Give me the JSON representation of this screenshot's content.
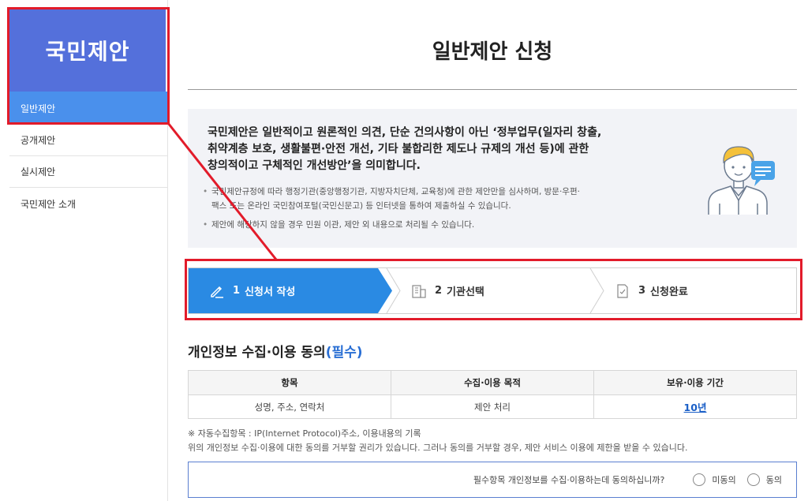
{
  "sidebar": {
    "title": "국민제안",
    "items": [
      {
        "label": "일반제안"
      },
      {
        "label": "공개제안"
      },
      {
        "label": "실시제안"
      },
      {
        "label": "국민제안 소개"
      }
    ]
  },
  "main": {
    "title": "일반제안 신청",
    "info": {
      "lead_lines": [
        "국민제안은 일반적이고 원론적인 의견, 단순 건의사항이 아닌 ‘정부업무(일자리 창출,",
        "취약계층 보호, 생활불편·안전 개선, 기타 불합리한 제도나 규제의 개선 등)에 관한",
        "창의적이고 구체적인 개선방안’을 의미합니다."
      ],
      "bullets": [
        {
          "line1": "국민제안규정에 따라 행정기관(중앙행정기관, 지방자치단체, 교육청)에 관한 제안만을 심사하며, 방문·우편·",
          "line2": "팩스 또는 온라인 국민참여포털(국민신문고) 등 인터넷을 통하여 제출하실 수 있습니다."
        },
        {
          "line1": "제안에 해당하지 않을 경우 민원 이관, 제안 외 내용으로 처리될 수 있습니다."
        }
      ]
    },
    "steps": [
      {
        "num": "1",
        "label": "신청서 작성",
        "icon": "pencil-icon",
        "active": true
      },
      {
        "num": "2",
        "label": "기관선택",
        "icon": "building-icon",
        "active": false
      },
      {
        "num": "3",
        "label": "신청완료",
        "icon": "document-check-icon",
        "active": false
      }
    ],
    "privacy": {
      "title": "개인정보 수집·이용 동의",
      "required": "(필수)",
      "columns": [
        "항목",
        "수집·이용 목적",
        "보유·이용 기간"
      ],
      "rows": [
        [
          "성명, 주소, 연락처",
          "제안 처리",
          "10년"
        ]
      ],
      "note1": "※ 자동수집항목 : IP(Internet Protocol)주소, 이용내용의 기록",
      "note2": "위의 개인정보 수집·이용에 대한 동의를 거부할 권리가 있습니다. 그러나 동의를 거부할 경우, 제안 서비스 이용에 제한을 받을 수 있습니다.",
      "question": "필수항목 개인정보를 수집·이용하는데 동의하십니까?",
      "options": [
        "미동의",
        "동의"
      ]
    }
  },
  "colors": {
    "sidebar_header": "#5470db",
    "active_item": "#4a90ec",
    "active_step": "#2a8ae3",
    "annotation": "#e21b2a",
    "required_text": "#2a6fd4"
  }
}
